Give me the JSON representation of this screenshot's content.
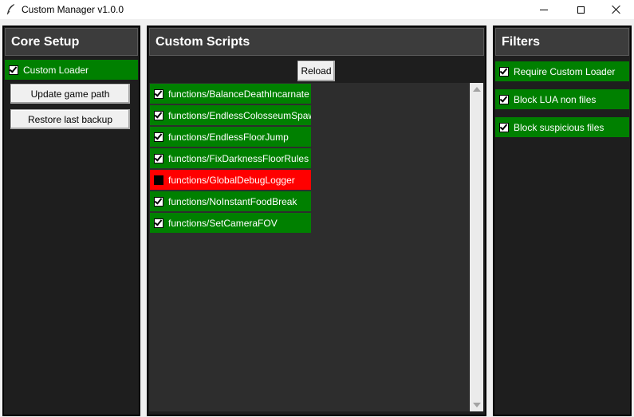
{
  "window": {
    "title": "Custom Manager v1.0.0"
  },
  "core_setup": {
    "title": "Core Setup",
    "loader_toggle": {
      "label": "Custom Loader",
      "checked": true
    },
    "update_button": "Update game path",
    "restore_button": "Restore last backup"
  },
  "custom_scripts": {
    "title": "Custom Scripts",
    "reload_button": "Reload",
    "scripts": [
      {
        "label": "functions/BalanceDeathIncarnate",
        "checked": true
      },
      {
        "label": "functions/EndlessColosseumSpaw",
        "checked": true
      },
      {
        "label": "functions/EndlessFloorJump",
        "checked": true
      },
      {
        "label": "functions/FixDarknessFloorRules",
        "checked": true
      },
      {
        "label": "functions/GlobalDebugLogger",
        "checked": false
      },
      {
        "label": "functions/NoInstantFoodBreak",
        "checked": true
      },
      {
        "label": "functions/SetCameraFOV",
        "checked": true
      }
    ]
  },
  "filters": {
    "title": "Filters",
    "items": [
      {
        "label": "Require Custom Loader",
        "checked": true
      },
      {
        "label": "Block LUA non files",
        "checked": true
      },
      {
        "label": "Block suspicious files",
        "checked": true
      }
    ]
  },
  "colors": {
    "enabled": "#008000",
    "disabled": "#ff0000",
    "panel_bg": "#1e1e1e",
    "header_bg": "#3c3c3c"
  }
}
